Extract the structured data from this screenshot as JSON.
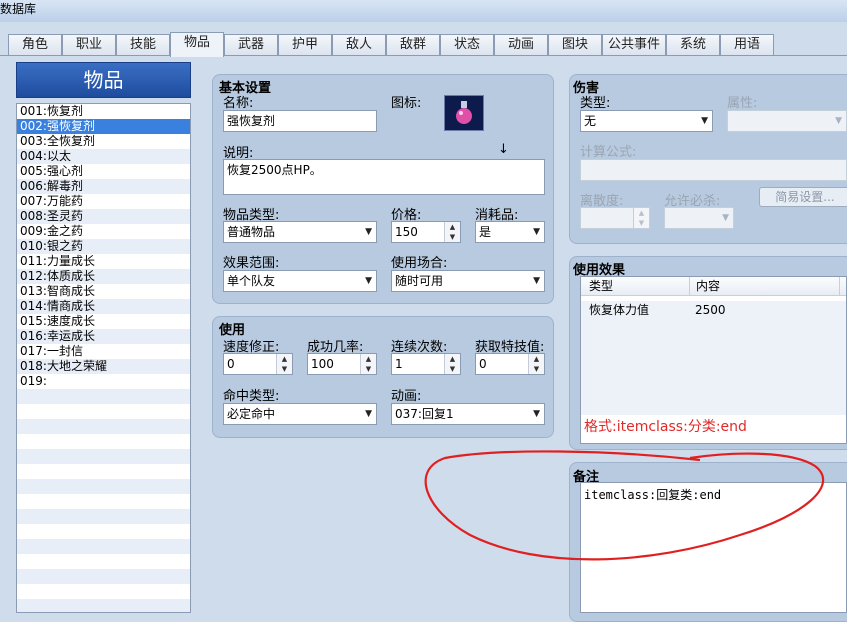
{
  "window": {
    "title": "数据库"
  },
  "tabs": [
    {
      "label": "角色"
    },
    {
      "label": "职业"
    },
    {
      "label": "技能"
    },
    {
      "label": "物品"
    },
    {
      "label": "武器"
    },
    {
      "label": "护甲"
    },
    {
      "label": "敌人"
    },
    {
      "label": "敌群"
    },
    {
      "label": "状态"
    },
    {
      "label": "动画"
    },
    {
      "label": "图块"
    },
    {
      "label": "公共事件"
    },
    {
      "label": "系统"
    },
    {
      "label": "用语"
    }
  ],
  "list": {
    "title": "物品",
    "items": [
      "001:恢复剂",
      "002:强恢复剂",
      "003:全恢复剂",
      "004:以太",
      "005:强心剂",
      "006:解毒剂",
      "007:万能药",
      "008:圣灵药",
      "009:金之药",
      "010:银之药",
      "011:力量成长",
      "012:体质成长",
      "013:智商成长",
      "014:情商成长",
      "015:速度成长",
      "016:幸运成长",
      "017:一封信",
      "018:大地之荣耀",
      "019:"
    ],
    "selected_index": 1
  },
  "basic": {
    "title": "基本设置",
    "name_label": "名称:",
    "name_value": "强恢复剂",
    "icon_label": "图标:",
    "desc_label": "说明:",
    "desc_value": "恢复2500点HP。",
    "cursor_glyph": "↓",
    "type_label": "物品类型:",
    "type_value": "普通物品",
    "price_label": "价格:",
    "price_value": "150",
    "consumable_label": "消耗品:",
    "consumable_value": "是",
    "scope_label": "效果范围:",
    "scope_value": "单个队友",
    "occasion_label": "使用场合:",
    "occasion_value": "随时可用"
  },
  "usage": {
    "title": "使用",
    "speed_label": "速度修正:",
    "speed_value": "0",
    "success_label": "成功几率:",
    "success_value": "100",
    "repeat_label": "连续次数:",
    "repeat_value": "1",
    "tp_label": "获取特技值:",
    "tp_value": "0",
    "hit_label": "命中类型:",
    "hit_value": "必定命中",
    "anim_label": "动画:",
    "anim_value": "037:回复1"
  },
  "damage": {
    "title": "伤害",
    "type_label": "类型:",
    "type_value": "无",
    "element_label": "属性:",
    "formula_label": "计算公式:",
    "variance_label": "离散度:",
    "critical_label": "允许必杀:",
    "easy_button": "简易设置..."
  },
  "effects": {
    "title": "使用效果",
    "col_type": "类型",
    "col_content": "内容",
    "rows": [
      {
        "type": "恢复体力值",
        "content": "2500"
      }
    ]
  },
  "annotation": "格式:itemclass:分类:end",
  "note": {
    "title": "备注",
    "value": "itemclass:回复类:end"
  },
  "colors": {
    "annotation": "#e02a2a",
    "selection": "#3a80de",
    "list_header": "#2a5bb0"
  }
}
